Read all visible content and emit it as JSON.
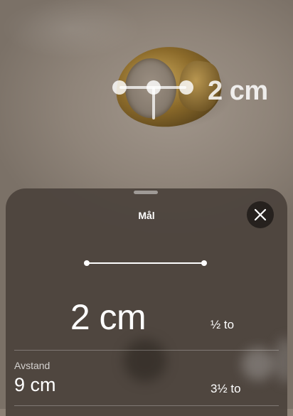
{
  "ar_overlay": {
    "measurement_label": "2 cm"
  },
  "sheet": {
    "title": "Mål",
    "close_icon": "close-icon",
    "primary": {
      "value": "2 cm",
      "ring_size": "½ to"
    },
    "rows": [
      {
        "label": "Avstand",
        "value": "9 cm",
        "ring_size": "3½ to"
      }
    ]
  }
}
